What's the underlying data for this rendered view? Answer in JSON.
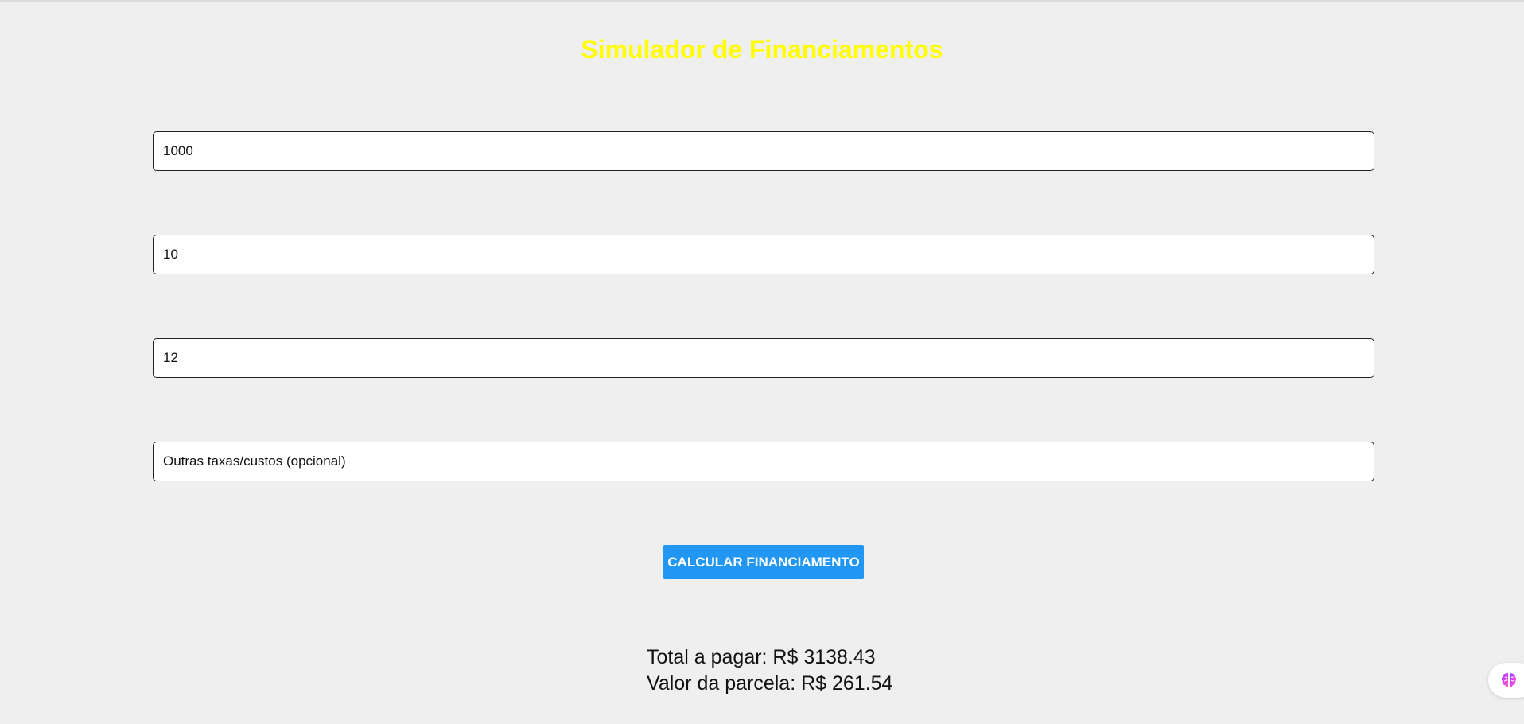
{
  "page": {
    "title": "Simulador de Financiamentos"
  },
  "form": {
    "amount": {
      "value": "1000",
      "placeholder": ""
    },
    "rate": {
      "value": "10",
      "placeholder": ""
    },
    "installments": {
      "value": "12",
      "placeholder": ""
    },
    "other_costs": {
      "value": "",
      "placeholder": "Outras taxas/custos (opcional)"
    },
    "calculate_label": "CALCULAR FINANCIAMENTO"
  },
  "results": {
    "total": "Total a pagar: R$ 3138.43",
    "installment": "Valor da parcela: R$ 261.54"
  },
  "extension": {
    "icon": "brain-icon"
  },
  "colors": {
    "title": "#ffff00",
    "button": "#2196f3",
    "background": "#efefef"
  }
}
